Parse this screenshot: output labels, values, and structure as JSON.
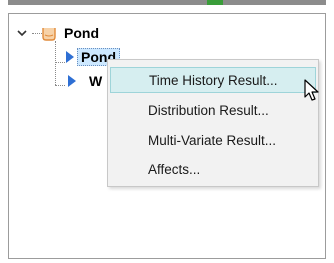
{
  "tree": {
    "root": {
      "label": "Pond",
      "expanded": true
    },
    "children": [
      {
        "label": "Pond",
        "selected": true
      },
      {
        "label": "W"
      }
    ]
  },
  "context_menu": {
    "items": [
      {
        "label": "Time History Result...",
        "hovered": true
      },
      {
        "label": "Distribution Result..."
      },
      {
        "label": "Multi-Variate Result..."
      },
      {
        "label": "Affects..."
      }
    ]
  },
  "colors": {
    "menu_hover_bg": "#d6eef0",
    "selection_bg": "#cde8ff",
    "arrow_blue": "#2e6fd4",
    "folder_orange": "#f0a868"
  },
  "icons": [
    "chevron-down-icon",
    "pond-container-icon",
    "triangle-right-icon",
    "pointer-cursor-icon"
  ]
}
